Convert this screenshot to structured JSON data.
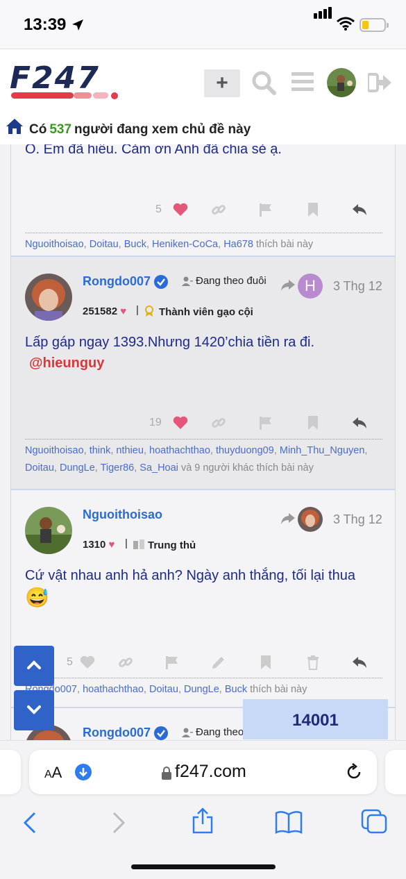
{
  "status": {
    "time": "13:39"
  },
  "header": {
    "logo_text": "F247",
    "add_label": "+"
  },
  "viewer_bar": {
    "prefix": "Có",
    "count": "537",
    "suffix": "người đang xem chủ đề này"
  },
  "posts": [
    {
      "text": "Ồ. Em đã hiểu. Cảm ơn Anh đã chia sẻ ạ.",
      "like_count": "5",
      "likers": [
        "Nguoithoisao",
        "Doitau",
        "Buck",
        "Heniken-CoCa",
        "Ha678"
      ],
      "likes_suffix": "thích bài này"
    },
    {
      "username": "Rongdo007",
      "follow_label": "Đang theo đuôi",
      "reply_initial": "H",
      "date": "3 Thg 12",
      "points": "251582",
      "rank": "Thành viên gạo cội",
      "text": "Lấp gáp ngay 1393.Nhưng 1420’chia tiền ra đi.",
      "mention": "@hieunguy",
      "like_count": "19",
      "likers": [
        "Nguoithoisao",
        "think",
        "nthieu",
        "hoathachthao",
        "thuyduong09",
        "Minh_Thu_Nguyen",
        "Doitau",
        "DungLe",
        "Tiger86",
        "Sa_Hoai"
      ],
      "likes_suffix": "và 9 người khác thích bài này"
    },
    {
      "username": "Nguoithoisao",
      "date": "3 Thg 12",
      "points": "1310",
      "rank": "Trung thủ",
      "text": "Cứ vật nhau anh hả anh? Ngày anh thắng, tối lại thua",
      "emoji": "😅",
      "like_count": "5",
      "likers": [
        "Rongdo007",
        "hoathachthao",
        "Doitau",
        "DungLe",
        "Buck"
      ],
      "likes_suffix": "thích bài này"
    },
    {
      "username": "Rongdo007",
      "follow_label": "Đang theo"
    }
  ],
  "progress_counter": "14001",
  "browser": {
    "aa_small": "A",
    "aa_large": "A",
    "url": "f247.com"
  },
  "colors": {
    "accent": "#2a6bd6",
    "post_text": "#1d2a87",
    "mention": "#d9383a",
    "like": "#e3577a",
    "floating": "#2f63c8"
  }
}
